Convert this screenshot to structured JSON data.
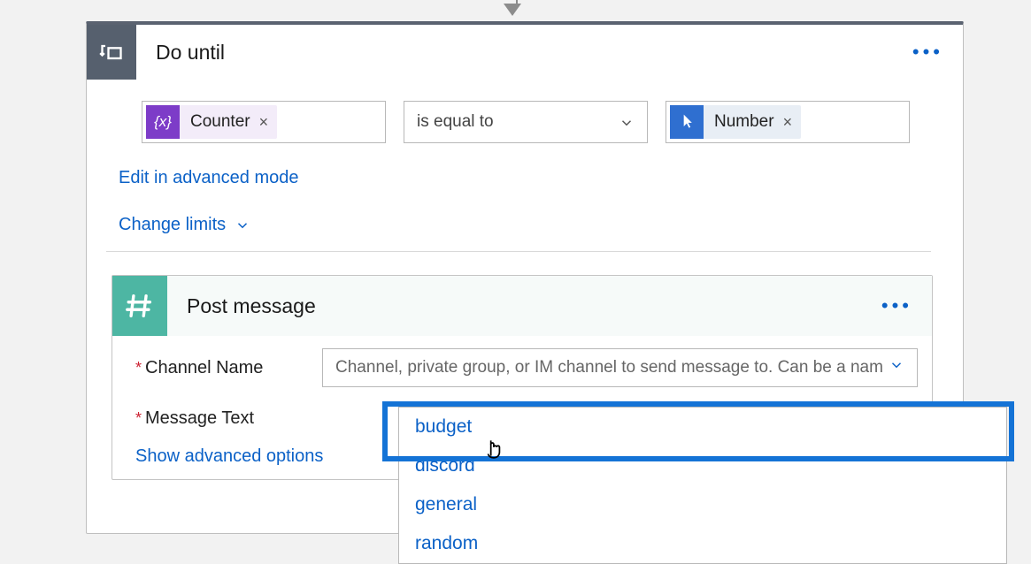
{
  "do_until": {
    "title": "Do until",
    "left_token_label": "Counter",
    "operator": "is equal to",
    "right_token_label": "Number",
    "edit_advanced": "Edit in advanced mode",
    "change_limits": "Change limits"
  },
  "post_message": {
    "title": "Post message",
    "channel_label": "Channel Name",
    "channel_placeholder": "Channel, private group, or IM channel to send message to. Can be a nam",
    "message_label": "Message Text",
    "show_advanced": "Show advanced options",
    "dropdown_options": [
      "budget",
      "discord",
      "general",
      "random"
    ],
    "selected_option": "budget"
  },
  "icons": {
    "variable_glyph": "{x}",
    "hash_glyph": "#"
  }
}
